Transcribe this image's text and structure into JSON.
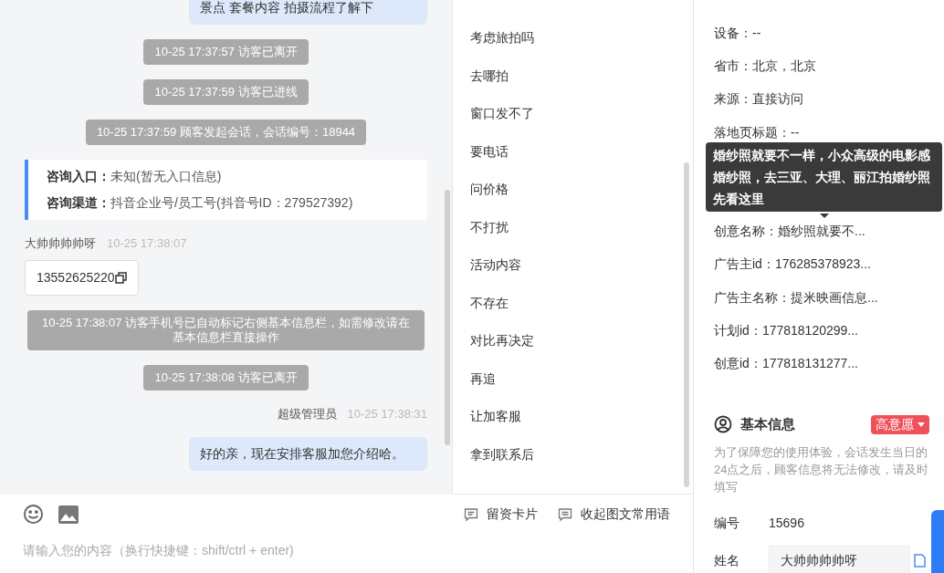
{
  "chat": {
    "messages": [
      {
        "kind": "bubble",
        "text": "景点 套餐内容 拍摄流程了解下"
      },
      {
        "kind": "system",
        "text": "10-25 17:37:57 访客已离开"
      },
      {
        "kind": "system",
        "text": "10-25 17:37:59 访客已进线"
      },
      {
        "kind": "system",
        "text": "10-25 17:37:59 顾客发起会话，会话编号：18944"
      },
      {
        "kind": "entry",
        "rows": [
          {
            "label": "咨询入口：",
            "value": "未知(暂无入口信息)"
          },
          {
            "label": "咨询渠道：",
            "value": "抖音企业号/员工号(抖音号ID：279527392)"
          }
        ]
      },
      {
        "kind": "visitor_sender",
        "name": "大帅帅帅帅呀",
        "time": "10-25 17:38:07"
      },
      {
        "kind": "phone",
        "text": "13552625220"
      },
      {
        "kind": "system",
        "text": "10-25 17:38:07 访客手机号已自动标记右侧基本信息栏，如需修改请在基本信息栏直接操作"
      },
      {
        "kind": "system",
        "text": "10-25 17:38:08 访客已离开"
      },
      {
        "kind": "agent_sender",
        "name": "超级管理员",
        "time": "10-25 17:38:31"
      },
      {
        "kind": "bubble",
        "text": "好的亲，现在安排客服加您介绍哈。"
      }
    ]
  },
  "quick_replies": [
    "考虑旅拍吗",
    "去哪拍",
    "窗口发不了",
    "要电话",
    "问价格",
    "不打扰",
    "活动内容",
    "不存在",
    "对比再决定",
    "再追",
    "让加客服",
    "拿到联系后"
  ],
  "composer": {
    "tools": [
      {
        "kind": "card",
        "label": "留资卡片"
      },
      {
        "kind": "phrases",
        "label": "收起图文常用语"
      }
    ],
    "placeholder": "请输入您的内容（换行快捷键：shift/ctrl + enter)"
  },
  "visitor_info": {
    "rows": [
      "设备：--",
      "省市：北京，北京",
      "来源：直接访问",
      "落地页标题：--",
      null,
      null,
      "创意名称：婚纱照就要不...",
      "广告主id：176285378923...",
      "广告主名称：提米映画信息...",
      "计划id：177818120299...",
      "创意id：177818131277..."
    ],
    "tooltip": "婚纱照就要不一样，小众高级的电影感婚纱照，去三亚、大理、丽江拍婚纱照先看这里"
  },
  "basic_info": {
    "title": "基本信息",
    "intent": "高意愿",
    "notice": "为了保障您的使用体验，会话发生当日的24点之后，顾客信息将无法修改，请及时填写",
    "fields": [
      {
        "kind": "text",
        "label": "编号",
        "value": "15696"
      },
      {
        "kind": "input",
        "label": "姓名",
        "value": "大帅帅帅帅呀"
      }
    ]
  }
}
